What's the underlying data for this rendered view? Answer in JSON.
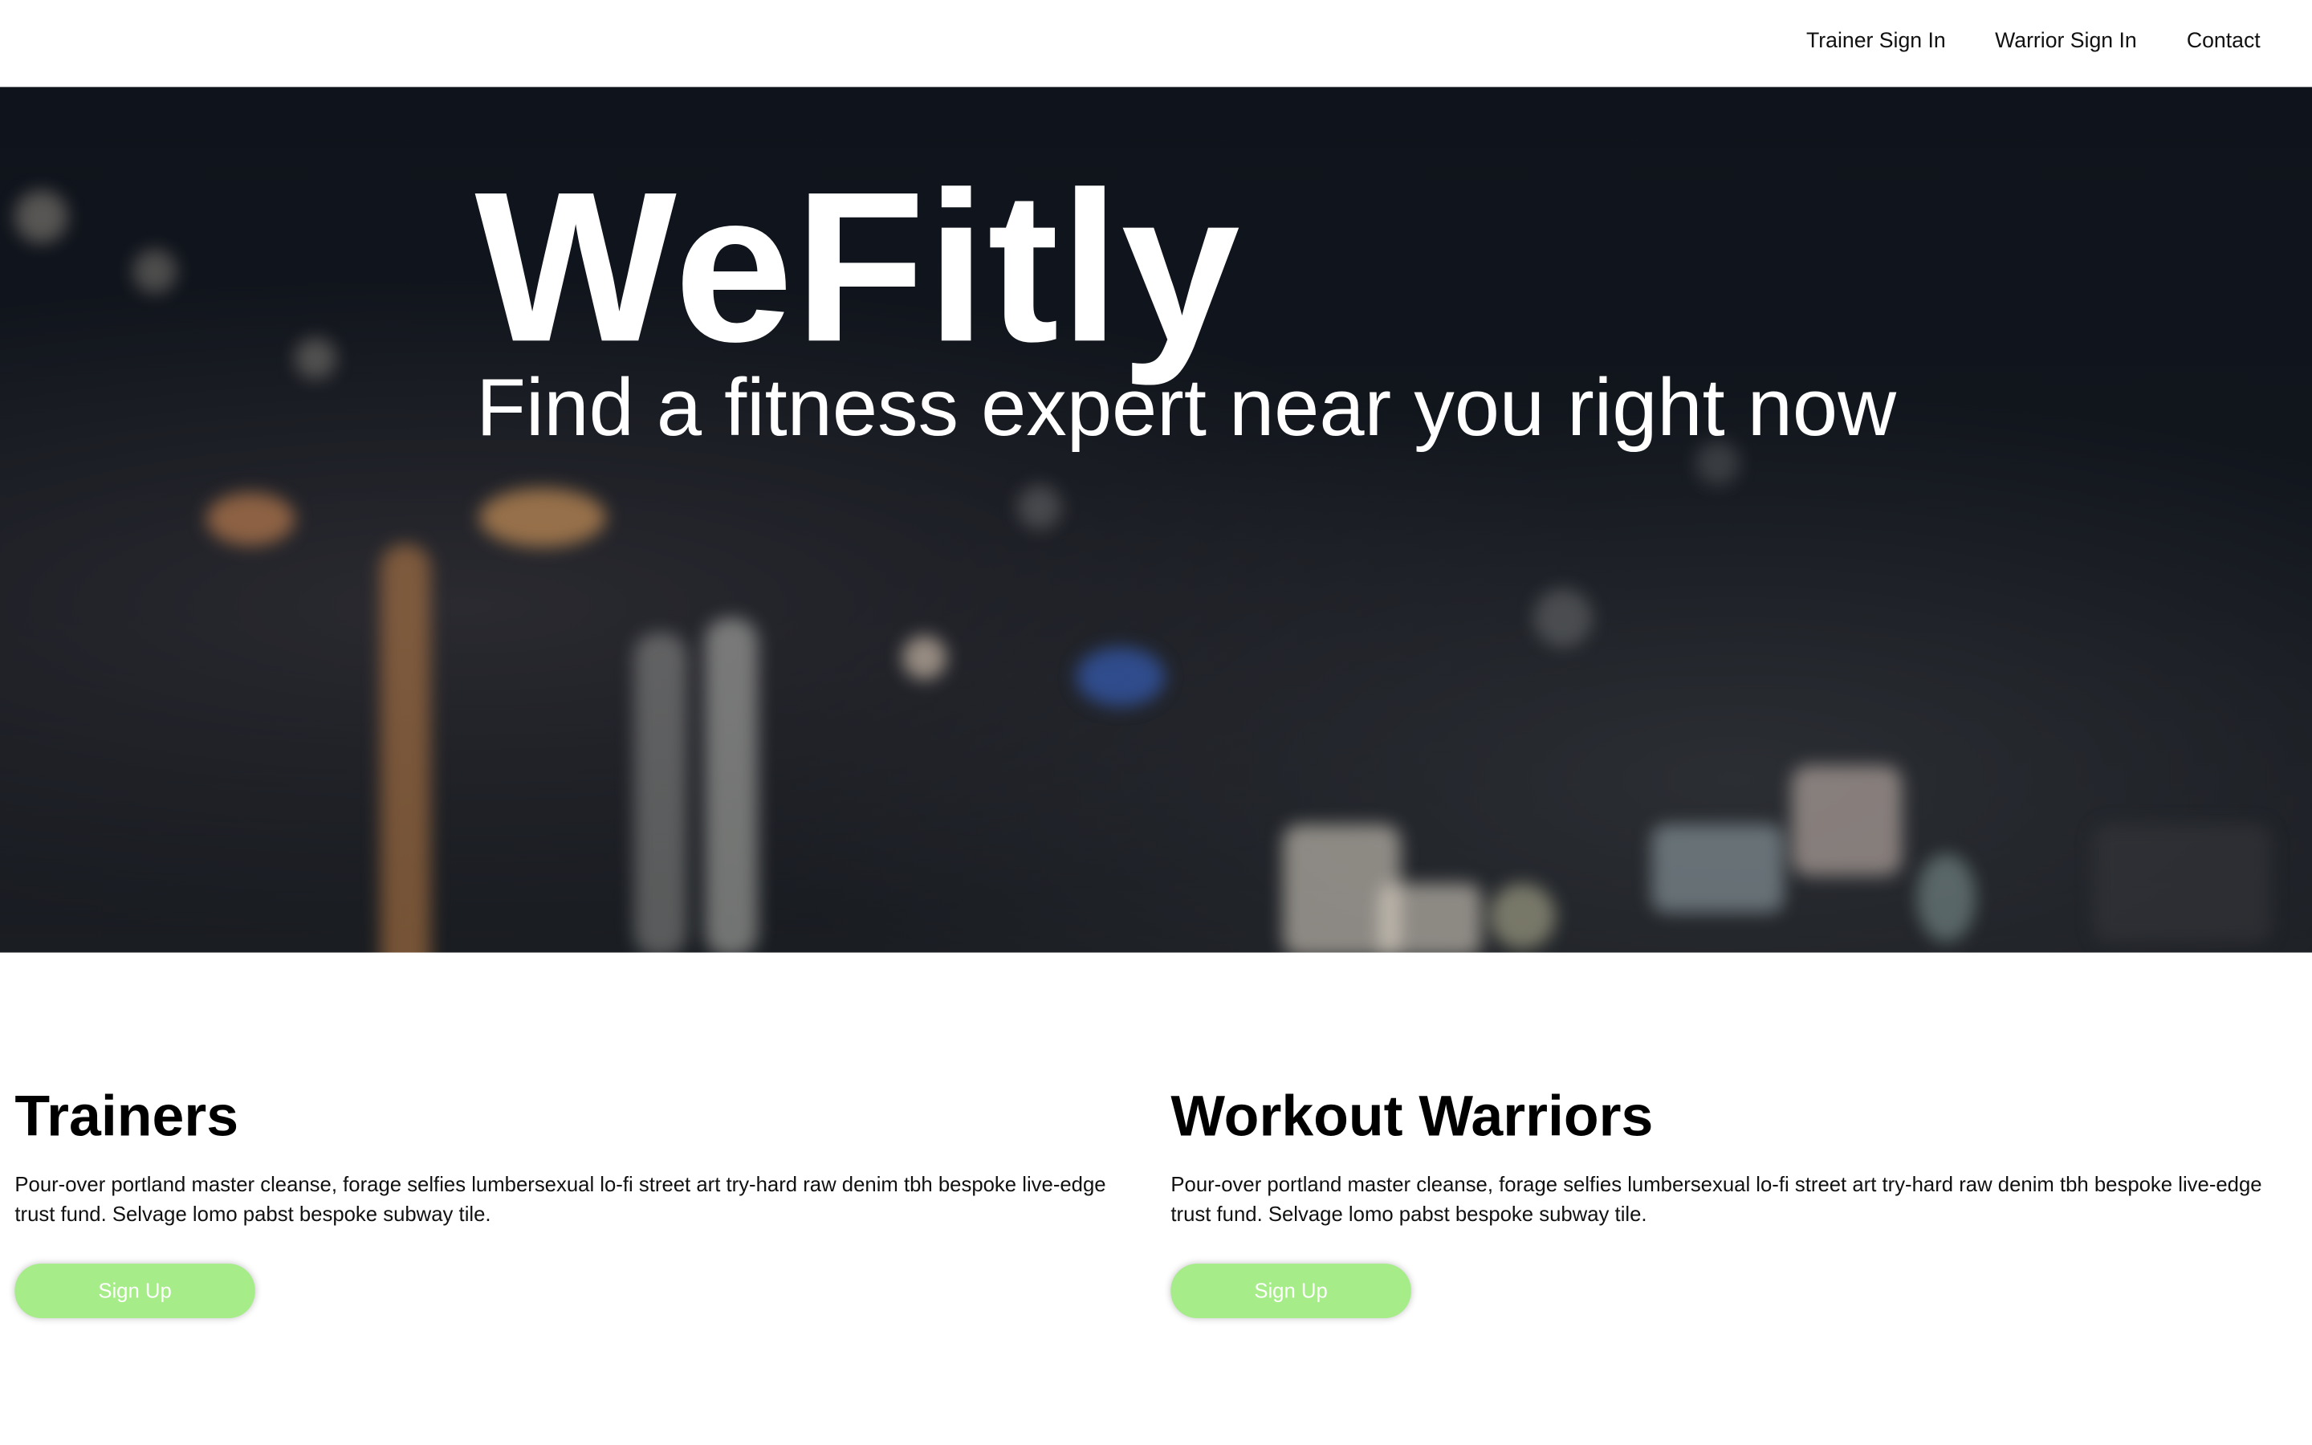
{
  "nav": {
    "links": [
      "Trainer Sign In",
      "Warrior Sign In",
      "Contact"
    ]
  },
  "hero": {
    "title": "WeFitly",
    "subtitle": "Find a fitness expert near you right now"
  },
  "sections": [
    {
      "heading": "Trainers",
      "body": "Pour-over portland master cleanse, forage selfies lumbersexual lo-fi street art try-hard raw denim tbh bespoke live-edge trust fund. Selvage lomo pabst bespoke subway tile.",
      "button": "Sign Up"
    },
    {
      "heading": "Workout Warriors",
      "body": "Pour-over portland master cleanse, forage selfies lumbersexual lo-fi street art try-hard raw denim tbh bespoke live-edge trust fund. Selvage lomo pabst bespoke subway tile.",
      "button": "Sign Up"
    }
  ],
  "colors": {
    "button_bg": "#a6ec89",
    "hero_bg": "#11151c"
  }
}
